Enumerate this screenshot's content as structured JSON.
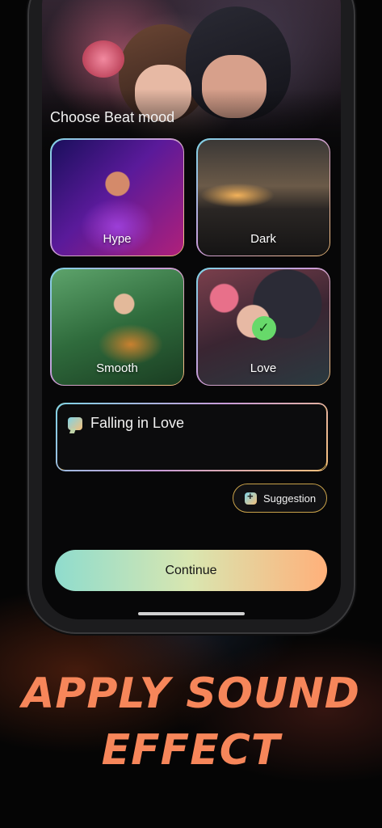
{
  "screen": {
    "section_title": "Choose Beat mood",
    "moods": [
      {
        "label": "Hype",
        "selected": false
      },
      {
        "label": "Dark",
        "selected": false
      },
      {
        "label": "Smooth",
        "selected": false
      },
      {
        "label": "Love",
        "selected": true
      }
    ],
    "prompt_input": {
      "value": "Falling in Love",
      "icon": "chat-bubble-icon"
    },
    "suggestion_button": {
      "label": "Suggestion",
      "icon": "sparkle-icon"
    },
    "continue_button": {
      "label": "Continue"
    }
  },
  "promo": {
    "headline_line1": "APPLY SOUND",
    "headline_line2": "EFFECT"
  },
  "colors": {
    "accent_orange": "#f6865a",
    "selected_check": "#67d96a",
    "button_gradient_start": "#8fdccd",
    "button_gradient_end": "#ffb07a"
  }
}
